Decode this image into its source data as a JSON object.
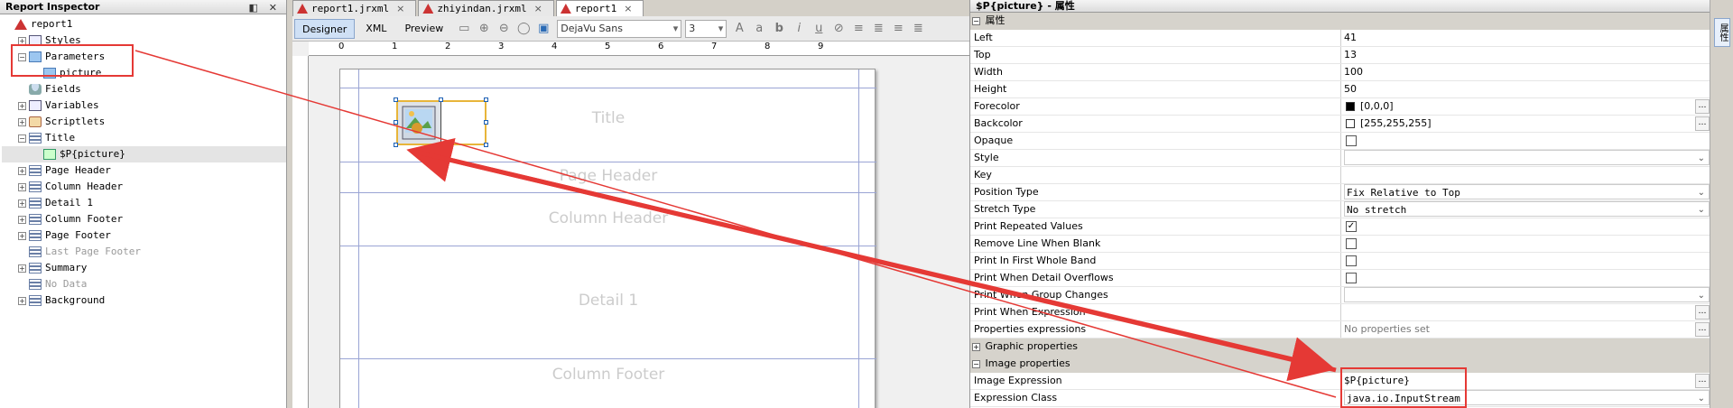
{
  "inspector": {
    "title": "Report Inspector",
    "controls": "◧ ✕",
    "tree": [
      {
        "label": "report1",
        "level": 0,
        "icon": "report-icon",
        "exp": ""
      },
      {
        "label": "Styles",
        "level": 1,
        "icon": "style-icon",
        "exp": "+"
      },
      {
        "label": "Parameters",
        "level": 1,
        "icon": "parameter-icon",
        "exp": "−"
      },
      {
        "label": "picture",
        "level": 2,
        "icon": "parameter-icon",
        "exp": ""
      },
      {
        "label": "Fields",
        "level": 1,
        "icon": "field-icon",
        "exp": ""
      },
      {
        "label": "Variables",
        "level": 1,
        "icon": "variable-icon",
        "exp": "+"
      },
      {
        "label": "Scriptlets",
        "level": 1,
        "icon": "scriptlet-icon",
        "exp": "+"
      },
      {
        "label": "Title",
        "level": 1,
        "icon": "band-icon",
        "exp": "−"
      },
      {
        "label": "$P{picture}",
        "level": 2,
        "icon": "image-icon",
        "exp": "",
        "selected": true
      },
      {
        "label": "Page Header",
        "level": 1,
        "icon": "band-icon",
        "exp": "+"
      },
      {
        "label": "Column Header",
        "level": 1,
        "icon": "band-icon",
        "exp": "+"
      },
      {
        "label": "Detail 1",
        "level": 1,
        "icon": "band-icon",
        "exp": "+"
      },
      {
        "label": "Column Footer",
        "level": 1,
        "icon": "band-icon",
        "exp": "+"
      },
      {
        "label": "Page Footer",
        "level": 1,
        "icon": "band-icon",
        "exp": "+"
      },
      {
        "label": "Last Page Footer",
        "level": 1,
        "icon": "band-icon",
        "exp": "",
        "muted": true
      },
      {
        "label": "Summary",
        "level": 1,
        "icon": "band-icon",
        "exp": "+"
      },
      {
        "label": "No Data",
        "level": 1,
        "icon": "band-icon",
        "exp": "",
        "muted": true
      },
      {
        "label": "Background",
        "level": 1,
        "icon": "band-icon",
        "exp": "+"
      }
    ]
  },
  "editor": {
    "tabs": [
      {
        "label": "report1.jrxml",
        "active": false
      },
      {
        "label": "zhiyindan.jrxml",
        "active": false
      },
      {
        "label": "report1",
        "active": true
      }
    ],
    "tab_close": "×",
    "views": [
      "Designer",
      "XML",
      "Preview"
    ],
    "font_name": "DejaVu Sans",
    "font_size": "3",
    "ruler_numbers": [
      "0",
      "1",
      "2",
      "3",
      "4",
      "5",
      "6",
      "7",
      "8",
      "9"
    ],
    "bands": [
      "Title",
      "Page Header",
      "Column Header",
      "Detail 1",
      "Column Footer"
    ]
  },
  "props": {
    "title": "$P{picture} - 属性",
    "section": "属性",
    "rows": [
      {
        "k": "Left",
        "v": "41"
      },
      {
        "k": "Top",
        "v": "13"
      },
      {
        "k": "Width",
        "v": "100"
      },
      {
        "k": "Height",
        "v": "50"
      },
      {
        "k": "Forecolor",
        "v": "[0,0,0]",
        "swatch": "#000000",
        "btn": true
      },
      {
        "k": "Backcolor",
        "v": "[255,255,255]",
        "swatch": "#ffffff",
        "btn": true
      },
      {
        "k": "Opaque",
        "checkbox": false
      },
      {
        "k": "Style",
        "combo": true,
        "v": ""
      },
      {
        "k": "Key",
        "v": ""
      },
      {
        "k": "Position Type",
        "combo": true,
        "v": "Fix Relative to Top"
      },
      {
        "k": "Stretch Type",
        "combo": true,
        "v": "No stretch"
      },
      {
        "k": "Print Repeated Values",
        "checkbox": true
      },
      {
        "k": "Remove Line When Blank",
        "checkbox": false
      },
      {
        "k": "Print In First Whole Band",
        "checkbox": false
      },
      {
        "k": "Print When Detail Overflows",
        "checkbox": false
      },
      {
        "k": "Print When Group Changes",
        "combo": true,
        "v": ""
      },
      {
        "k": "Print When Expression",
        "v": "",
        "btn": true
      },
      {
        "k": "Properties expressions",
        "v": "No properties set",
        "gray": true,
        "btn": true
      }
    ],
    "group_graphic": "Graphic properties",
    "group_image": "Image properties",
    "image_rows": [
      {
        "k": "Image Expression",
        "v": "$P{picture}",
        "btn": true
      },
      {
        "k": "Expression Class",
        "v": "java.io.InputStream",
        "combo": true
      }
    ]
  },
  "strip": {
    "label": "属性"
  },
  "colors": {
    "annotation": "#e53935",
    "selection": "#e8b53a",
    "band_line": "#9aa4d4"
  }
}
